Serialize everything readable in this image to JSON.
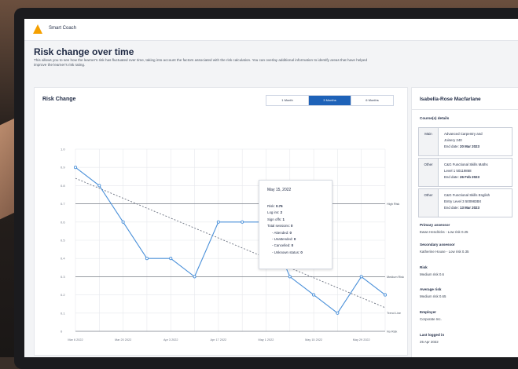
{
  "app": {
    "name": "Smart Coach"
  },
  "page": {
    "title": "Risk change over time",
    "description": "This allows you to see how the learner's risk has fluctuated over time, taking into account the factors associated with the risk calculation. You can overlay additional information to identify areas that have helped improve the learner's risk rating."
  },
  "chart_card": {
    "title": "Risk Change",
    "ranges": [
      "1 Month",
      "3 Months",
      "6 Months"
    ],
    "active_range": "3 Months"
  },
  "chart_data": {
    "type": "line",
    "x_ticks": [
      "Mar 6 2022",
      "Mar 20 2022",
      "Apr 3 2022",
      "Apr 17 2022",
      "May 1 2022",
      "May 15 2022",
      "May 29 2022"
    ],
    "y_ticks": [
      "1.0",
      "0.9",
      "0.8",
      "0.7",
      "0.6",
      "0.5",
      "0.4",
      "0.3",
      "0.2",
      "0.1",
      "0"
    ],
    "ylim": [
      0,
      1.0
    ],
    "series": [
      {
        "color": "#4a90d9",
        "points": [
          {
            "x": "2022-03-06",
            "y": 0.9
          },
          {
            "x": "2022-03-13",
            "y": 0.8
          },
          {
            "x": "2022-03-20",
            "y": 0.6
          },
          {
            "x": "2022-03-27",
            "y": 0.4
          },
          {
            "x": "2022-04-03",
            "y": 0.4
          },
          {
            "x": "2022-04-10",
            "y": 0.3
          },
          {
            "x": "2022-04-17",
            "y": 0.6
          },
          {
            "x": "2022-04-24",
            "y": 0.6
          },
          {
            "x": "2022-05-01",
            "y": 0.6
          },
          {
            "x": "2022-05-08",
            "y": 0.3
          },
          {
            "x": "2022-05-15",
            "y": 0.2
          },
          {
            "x": "2022-05-22",
            "y": 0.1
          },
          {
            "x": "2022-05-29",
            "y": 0.3
          },
          {
            "x": "2022-06-05",
            "y": 0.2
          }
        ]
      }
    ],
    "trend_line": {
      "label": "Trend Line",
      "start": 0.84,
      "end": 0.13
    },
    "reference_lines": [
      {
        "label": "High Risk",
        "y": 0.7
      },
      {
        "label": "Medium Risk",
        "y": 0.3
      },
      {
        "label": "No Risk",
        "y": 0.0
      }
    ],
    "grid": true
  },
  "tooltip": {
    "date": "May 15, 2022",
    "risk_label": "Risk:",
    "risk_value": "0.76",
    "logins_label": "Log ins:",
    "logins_value": "2",
    "signoffs_label": "Sign offs:",
    "signoffs_value": "1",
    "sessions_label": "Total sessions:",
    "sessions_value": "0",
    "attended_label": "- Attended:",
    "attended_value": "0",
    "unattended_label": "- Unattended:",
    "unattended_value": "0",
    "cancelled_label": "- Cancelled:",
    "cancelled_value": "0",
    "unknown_label": "- Unknown status:",
    "unknown_value": "0"
  },
  "learner": {
    "name": "Isabella-Rose Macfarlane",
    "courses_heading": "Course(s) details",
    "courses": [
      {
        "type": "Main",
        "line1": "Advanced Carpentry and",
        "line2": "Joinery 240",
        "end_label": "End date:",
        "end_date": "20 Mar 2023"
      },
      {
        "type": "Other",
        "line1": "C&G Functional Skills Maths",
        "line2": "Level 1 50119868",
        "end_label": "End date:",
        "end_date": "26 Feb 2023"
      },
      {
        "type": "Other",
        "line1": "C&G Functional Skills English",
        "line2": "Entry Level 3 500983BX",
        "end_label": "End date:",
        "end_date": "13 Mar 2023"
      }
    ],
    "primary_assessor_label": "Primary assessor",
    "primary_assessor_value": "Ewan Hendricks - Low risk 0.25",
    "secondary_assessor_label": "Secondary assessor",
    "secondary_assessor_value": "Katherine House - Low risk 0.35",
    "risk_label": "Risk",
    "risk_value": "Medium risk 0.6",
    "average_risk_label": "Average risk",
    "average_risk_value": "Medium risk 0.65",
    "employer_label": "Employer",
    "employer_value": "Corporate Inc.",
    "last_logged_label": "Last logged in",
    "last_logged_value": "25 Apr 2022"
  },
  "colors": {
    "accent": "#1e62b8",
    "line": "#4a90d9",
    "logo": "#f5a000"
  }
}
